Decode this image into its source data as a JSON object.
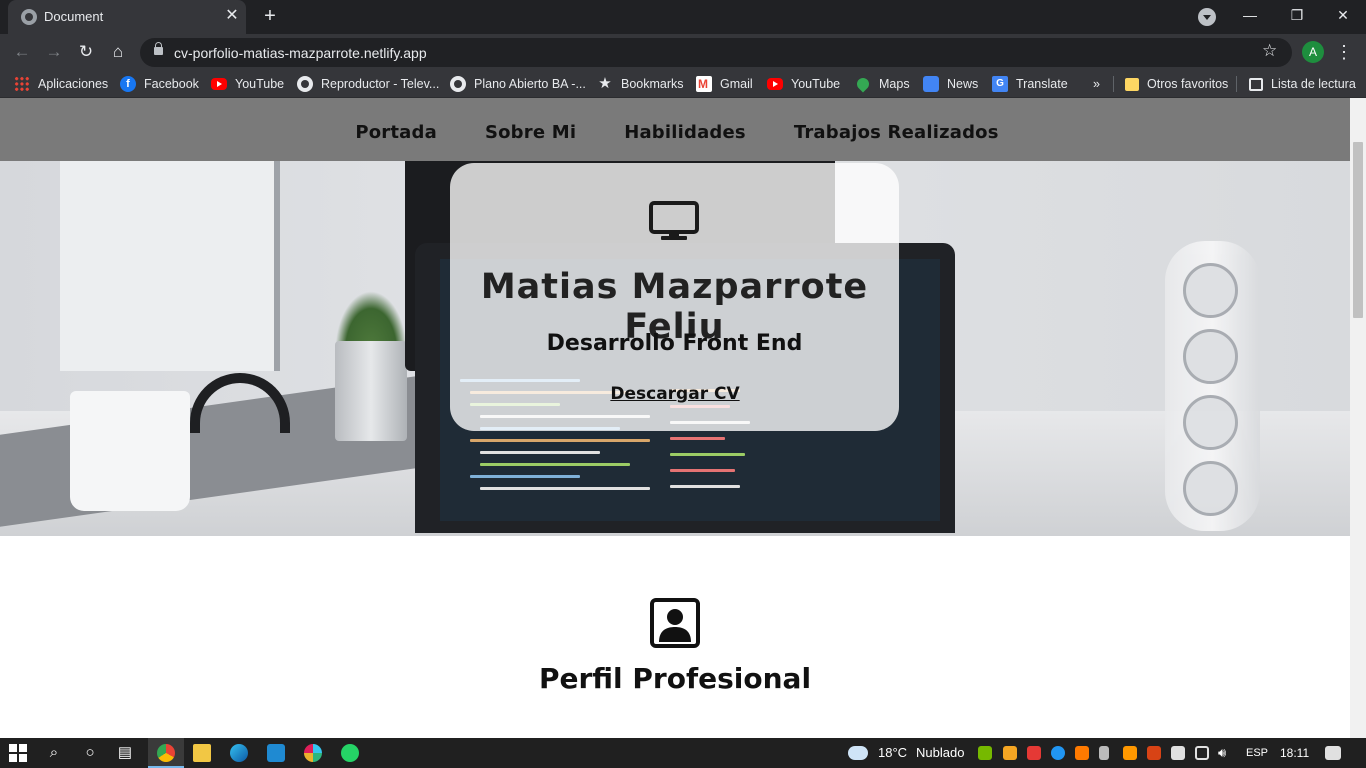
{
  "browser": {
    "tab_title": "Document",
    "tab_close": "✕",
    "new_tab": "+",
    "url": "cv-porfolio-matias-mazparrote.netlify.app",
    "profile_initial": "A",
    "window_controls": {
      "minimize": "—",
      "restore": "❐",
      "close": "✕"
    }
  },
  "bookmarks": [
    {
      "label": "Aplicaciones",
      "icon": "apps-grid-icon"
    },
    {
      "label": "Facebook",
      "icon": "facebook-icon"
    },
    {
      "label": "YouTube",
      "icon": "youtube-icon"
    },
    {
      "label": "Reproductor - Telev...",
      "icon": "globe-icon"
    },
    {
      "label": "Plano Abierto BA -...",
      "icon": "globe-icon"
    },
    {
      "label": "Bookmarks",
      "icon": "star-icon"
    },
    {
      "label": "Gmail",
      "icon": "gmail-icon"
    },
    {
      "label": "YouTube",
      "icon": "youtube-icon"
    },
    {
      "label": "Maps",
      "icon": "maps-icon"
    },
    {
      "label": "News",
      "icon": "news-icon"
    },
    {
      "label": "Translate",
      "icon": "translate-icon"
    }
  ],
  "bookmarks_overflow": "»",
  "bookmarks_right": [
    {
      "label": "Otros favoritos",
      "icon": "folder-icon"
    },
    {
      "label": "Lista de lectura",
      "icon": "reading-list-icon"
    }
  ],
  "site_nav": {
    "items": [
      "Portada",
      "Sobre Mi",
      "Habilidades",
      "Trabajos Realizados"
    ]
  },
  "hero": {
    "name": "Matias Mazparrote Feliu",
    "role": "Desarrollo Front End",
    "cv_button": "Descargar CV",
    "icon": "monitor-icon"
  },
  "profile_section": {
    "title": "Perfil Profesional",
    "icon": "id-badge-icon"
  },
  "taskbar": {
    "weather_temp": "18°C",
    "weather_desc": "Nublado",
    "language": "ESP",
    "time": "18:11"
  },
  "colors": {
    "chrome_dark": "#202124",
    "chrome_toolbar": "#35363a",
    "site_nav_bg": "#7a7a7a",
    "taskbar_bg": "#202020"
  }
}
